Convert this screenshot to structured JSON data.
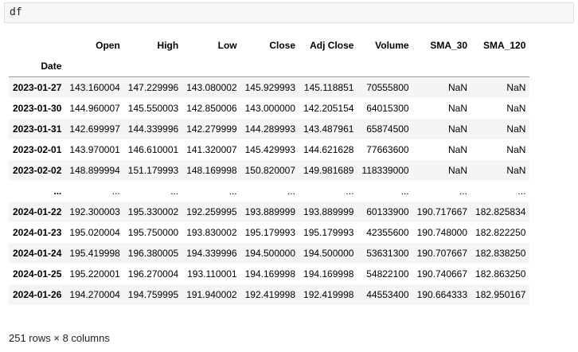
{
  "cell": {
    "code": "df"
  },
  "table": {
    "columns": [
      "Open",
      "High",
      "Low",
      "Close",
      "Adj Close",
      "Volume",
      "SMA_30",
      "SMA_120"
    ],
    "index_name": "Date",
    "rows": [
      {
        "index": "2023-01-27",
        "values": [
          "143.160004",
          "147.229996",
          "143.080002",
          "145.929993",
          "145.118851",
          "70555800",
          "NaN",
          "NaN"
        ]
      },
      {
        "index": "2023-01-30",
        "values": [
          "144.960007",
          "145.550003",
          "142.850006",
          "143.000000",
          "142.205154",
          "64015300",
          "NaN",
          "NaN"
        ]
      },
      {
        "index": "2023-01-31",
        "values": [
          "142.699997",
          "144.339996",
          "142.279999",
          "144.289993",
          "143.487961",
          "65874500",
          "NaN",
          "NaN"
        ]
      },
      {
        "index": "2023-02-01",
        "values": [
          "143.970001",
          "146.610001",
          "141.320007",
          "145.429993",
          "144.621628",
          "77663600",
          "NaN",
          "NaN"
        ]
      },
      {
        "index": "2023-02-02",
        "values": [
          "148.899994",
          "151.179993",
          "148.169998",
          "150.820007",
          "149.981689",
          "118339000",
          "NaN",
          "NaN"
        ]
      },
      {
        "index": "...",
        "values": [
          "...",
          "...",
          "...",
          "...",
          "...",
          "...",
          "...",
          "..."
        ]
      },
      {
        "index": "2024-01-22",
        "values": [
          "192.300003",
          "195.330002",
          "192.259995",
          "193.889999",
          "193.889999",
          "60133900",
          "190.717667",
          "182.825834"
        ]
      },
      {
        "index": "2024-01-23",
        "values": [
          "195.020004",
          "195.750000",
          "193.830002",
          "195.179993",
          "195.179993",
          "42355600",
          "190.748000",
          "182.822250"
        ]
      },
      {
        "index": "2024-01-24",
        "values": [
          "195.419998",
          "196.380005",
          "194.339996",
          "194.500000",
          "194.500000",
          "53631300",
          "190.707667",
          "182.838250"
        ]
      },
      {
        "index": "2024-01-25",
        "values": [
          "195.220001",
          "196.270004",
          "193.110001",
          "194.169998",
          "194.169998",
          "54822100",
          "190.740667",
          "182.863250"
        ]
      },
      {
        "index": "2024-01-26",
        "values": [
          "194.270004",
          "194.759995",
          "191.940002",
          "192.419998",
          "192.419998",
          "44553400",
          "190.664333",
          "182.950167"
        ]
      }
    ]
  },
  "footer": "251 rows × 8 columns"
}
